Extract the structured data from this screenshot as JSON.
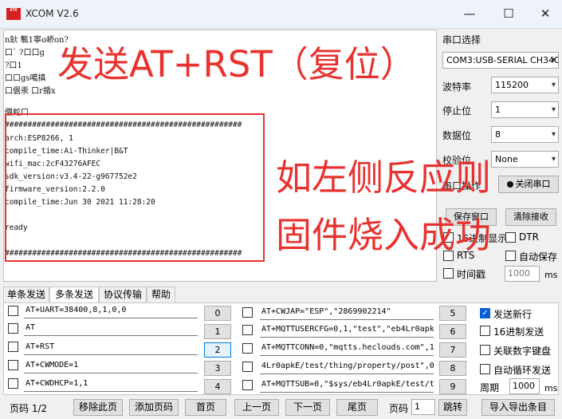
{
  "window": {
    "title": "XCOM V2.6",
    "icon_text": "ATK",
    "minimize": "—",
    "maximize": "☐",
    "close": "✕"
  },
  "receive": {
    "garbled": [
      "n鈥 甎1寧o峤on?",
      "口` ?口口g",
      "?口1",
      "口口gs噶搷",
      "口倨汞 口r揗x",
      "儠蛇口"
    ],
    "lines": [
      "####################################################",
      "arch:ESP8266, 1",
      "compile_time:Ai-Thinker|B&T",
      "wifi_mac:2cF43276AFEC",
      "sdk_version:v3.4-22-g967752e2",
      "firmware_version:2.2.0",
      "compile_time:Jun 30 2021 11:28:20",
      "",
      "ready",
      "",
      "####################################################"
    ]
  },
  "annotations": {
    "reset": "发送AT+RST（复位）",
    "left_reaction": "如左侧反应则",
    "flash_ok": "固件烧入成功"
  },
  "right_panel": {
    "port_label": "串口选择",
    "port_value": "COM3:USB-SERIAL CH340",
    "baud_label": "波特率",
    "baud_value": "115200",
    "stop_label": "停止位",
    "stop_value": "1",
    "data_label": "数据位",
    "data_value": "8",
    "parity_label": "校验位",
    "parity_value": "None",
    "op_label": "串口操作",
    "op_button": "关闭串口",
    "save_window": "保存窗口",
    "clear_receive": "清除接收",
    "hex_display": "16进制显示",
    "dtr": "DTR",
    "rts": "RTS",
    "auto_save": "自动保存",
    "timestamp": "时间戳",
    "timestamp_value": "1000",
    "timestamp_unit": "ms"
  },
  "tabs": [
    "单条发送",
    "多条发送",
    "协议传输",
    "帮助"
  ],
  "commands": [
    {
      "text": "AT+UART=38400,8,1,0,0",
      "btn": "0"
    },
    {
      "text": "AT",
      "btn": "1"
    },
    {
      "text": "AT+RST",
      "btn": "2"
    },
    {
      "text": "AT+CWMODE=1",
      "btn": "3"
    },
    {
      "text": "AT+CWDHCP=1,1",
      "btn": "4"
    },
    {
      "text": "AT+CWJAP=\"ESP\",\"2869902214\"",
      "btn": "5"
    },
    {
      "text": "AT+MQTTUSERCFG=0,1,\"test\",\"eb4Lr0apkE\",\"",
      "btn": "6"
    },
    {
      "text": "AT+MQTTCONN=0,\"mqtts.heclouds.com\",1",
      "btn": "7"
    },
    {
      "text": "4Lr0apkE/test/thing/property/post\",0",
      "btn": "8"
    },
    {
      "text": "AT+MQTTSUB=0,\"$sys/eb4Lr0apkE/test/t",
      "btn": "9"
    }
  ],
  "send_options": {
    "newline": "发送新行",
    "hex_send": "16进制发送",
    "link_keypad": "关联数字键盘",
    "auto_loop": "自动循环发送",
    "period_label": "周期",
    "period_value": "1000",
    "period_unit": "ms"
  },
  "bottom": {
    "page_info": "页码 1/2",
    "remove_page": "移除此页",
    "add_page": "添加页码",
    "first": "首页",
    "prev": "上一页",
    "next": "下一页",
    "last": "尾页",
    "page_label": "页码",
    "page_value": "1",
    "jump": "跳转",
    "import": "导入导出条目"
  }
}
